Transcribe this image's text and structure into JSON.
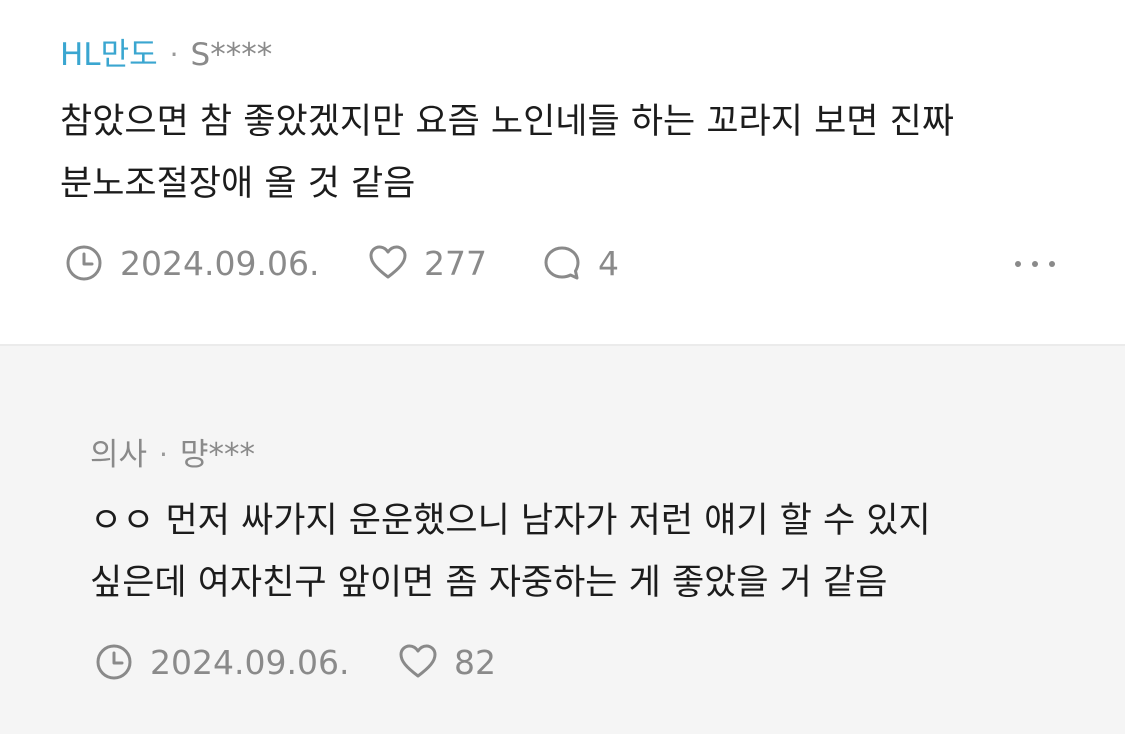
{
  "comment": {
    "company": "HL만도",
    "separator": "·",
    "nickname": "S****",
    "text_lines": [
      "참았으면 참 좋았겠지만 요즘 노인네들 하는 꼬라지 보면 진짜",
      "분노조절장애 올 것 같음"
    ],
    "date": "2024.09.06.",
    "likes": "277",
    "replies": "4"
  },
  "reply": {
    "company": "의사",
    "separator": "·",
    "nickname": "먕***",
    "text_lines": [
      "ㅇㅇ 먼저 싸가지 운운했으니 남자가 저런 얘기 할 수 있지",
      "싶은데 여자친구 앞이면 좀 자중하는 게 좋았을 거 같음"
    ],
    "date": "2024.09.06.",
    "likes": "82"
  },
  "colors": {
    "company_accent": "#3aa6d0",
    "meta_gray": "#8a8a8a",
    "reply_background": "#f5f5f5"
  },
  "icons": {
    "date": "clock-icon",
    "like": "heart-icon",
    "reply": "speech-bubble-icon",
    "more": "more-dots-icon"
  }
}
